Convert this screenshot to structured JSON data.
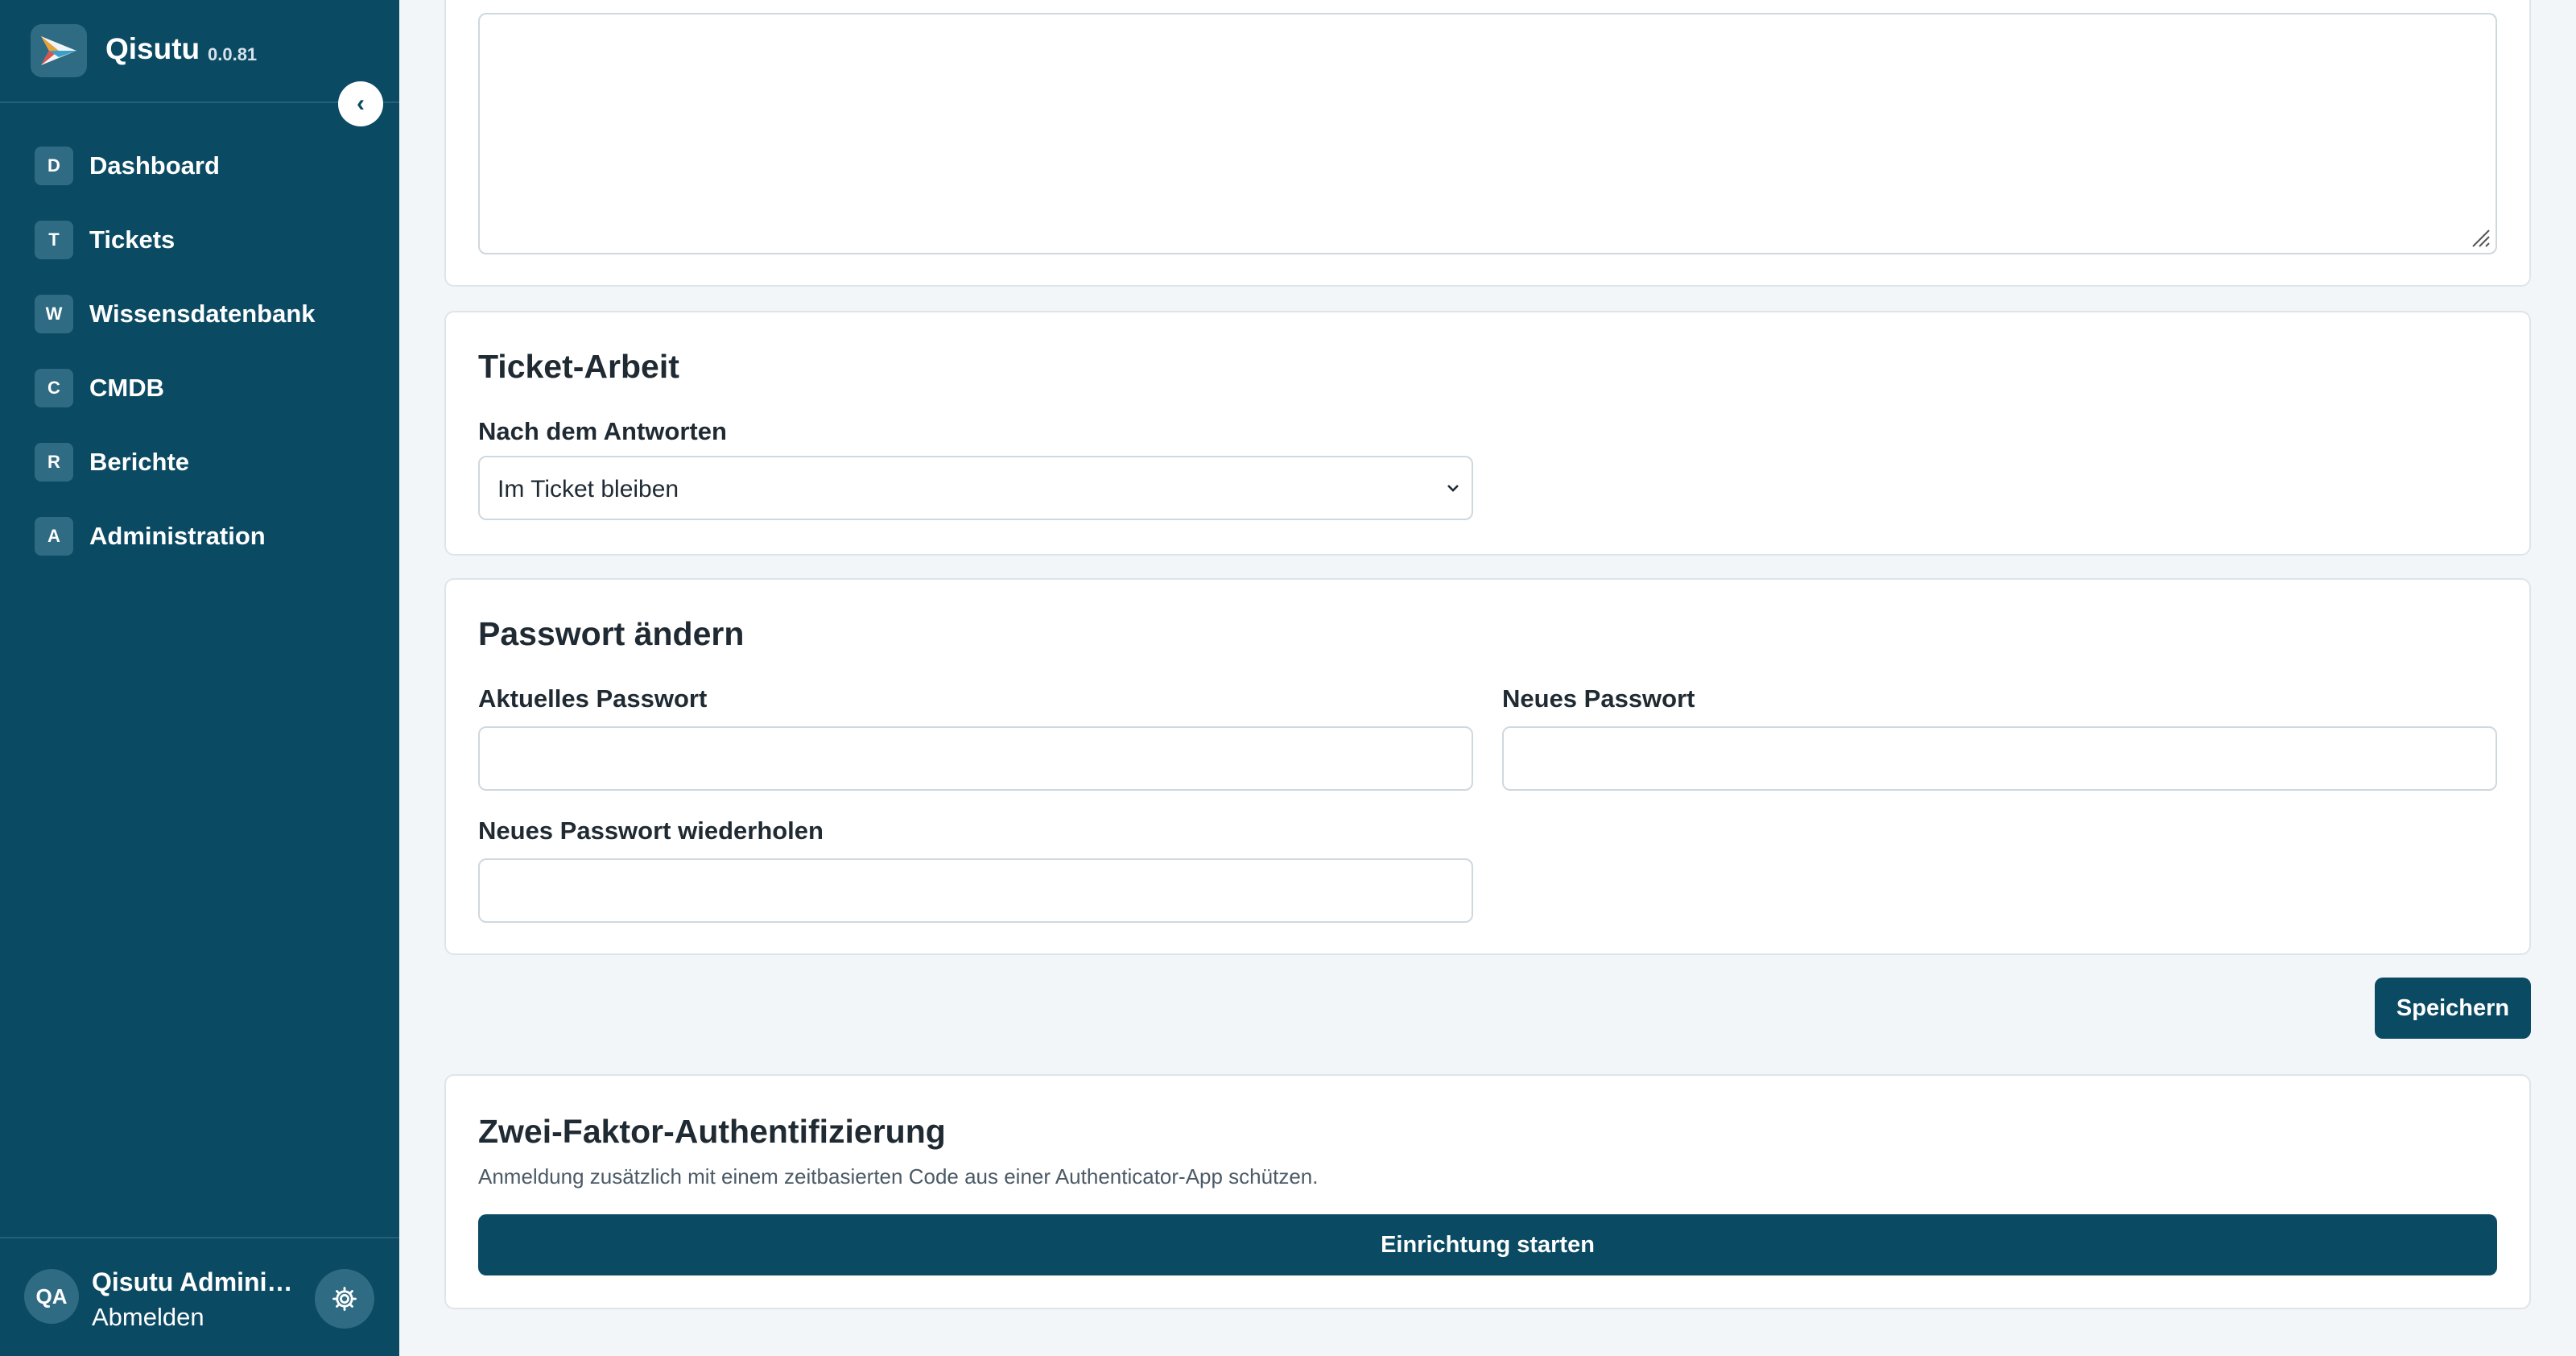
{
  "app": {
    "name": "Qisutu",
    "version": "0.0.81"
  },
  "sidebar": {
    "collapse_icon": "chevron-left-icon",
    "items": [
      {
        "badge": "D",
        "label": "Dashboard"
      },
      {
        "badge": "T",
        "label": "Tickets"
      },
      {
        "badge": "W",
        "label": "Wissensdatenbank"
      },
      {
        "badge": "C",
        "label": "CMDB"
      },
      {
        "badge": "R",
        "label": "Berichte"
      },
      {
        "badge": "A",
        "label": "Administration"
      }
    ],
    "user": {
      "initials": "QA",
      "name": "Qisutu Administrator",
      "logout": "Abmelden",
      "settings_icon": "gear-icon"
    }
  },
  "ticket_work": {
    "title": "Ticket-Arbeit",
    "after_reply_label": "Nach dem Antworten",
    "after_reply_value": "Im Ticket bleiben"
  },
  "password": {
    "title": "Passwort ändern",
    "current_label": "Aktuelles Passwort",
    "new_label": "Neues Passwort",
    "repeat_label": "Neues Passwort wiederholen"
  },
  "save_label": "Speichern",
  "two_factor": {
    "title": "Zwei-Faktor-Authentifizierung",
    "description": "Anmeldung zusätzlich mit einem zeitbasierten Code aus einer Authenticator-App schützen.",
    "button": "Einrichtung starten"
  },
  "colors": {
    "sidebar": "#0b4a63",
    "primary_button": "#0b4a63",
    "background": "#f3f6f9"
  }
}
